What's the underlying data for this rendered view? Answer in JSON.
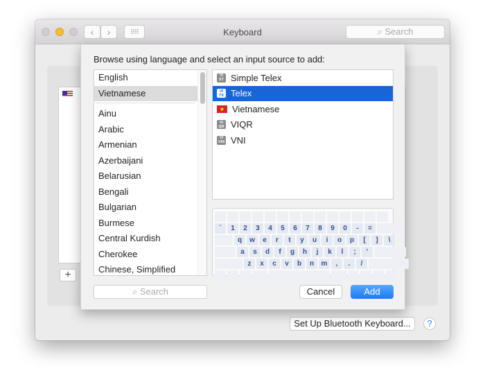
{
  "window": {
    "title": "Keyboard",
    "search_placeholder": "Search",
    "bluetooth_button": "Set Up Bluetooth Keyboard...",
    "help_label": "?",
    "add_source_label": "+"
  },
  "sheet": {
    "prompt": "Browse using language and select an input source to add:",
    "languages_top": [
      "English",
      "Vietnamese"
    ],
    "languages": [
      "Ainu",
      "Arabic",
      "Armenian",
      "Azerbaijani",
      "Belarusian",
      "Bengali",
      "Bulgarian",
      "Burmese",
      "Central Kurdish",
      "Cherokee",
      "Chinese, Simplified"
    ],
    "selected_language": "Vietnamese",
    "sources": [
      {
        "label": "Simple Telex",
        "icon": "VI ST"
      },
      {
        "label": "Telex",
        "icon": "VI TX",
        "selected": true
      },
      {
        "label": "Vietnamese",
        "icon": "vietnam-flag"
      },
      {
        "label": "VIQR",
        "icon": "VI QR"
      },
      {
        "label": "VNI",
        "icon": "VI VNI"
      }
    ],
    "keyboard_rows": [
      [
        "`",
        "1",
        "2",
        "3",
        "4",
        "5",
        "6",
        "7",
        "8",
        "9",
        "0",
        "-",
        "="
      ],
      [
        "q",
        "w",
        "e",
        "r",
        "t",
        "y",
        "u",
        "i",
        "o",
        "p",
        "[",
        "]",
        "\\"
      ],
      [
        "a",
        "s",
        "d",
        "f",
        "g",
        "h",
        "j",
        "k",
        "l",
        ";",
        "'"
      ],
      [
        "z",
        "x",
        "c",
        "v",
        "b",
        "n",
        "m",
        ",",
        ".",
        "/"
      ]
    ],
    "search_placeholder": "Search",
    "cancel_label": "Cancel",
    "add_label": "Add"
  },
  "colors": {
    "accent": "#1765d6",
    "close": "#cfcdcf",
    "minimize": "#f5bd2f"
  }
}
